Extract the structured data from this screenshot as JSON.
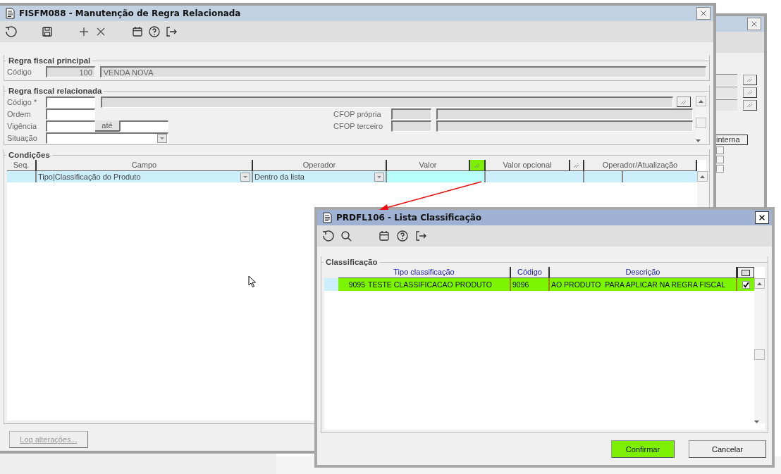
{
  "back_window": {
    "column_header": "interna",
    "checkboxes": [
      {
        "checked": false
      },
      {
        "checked": false
      },
      {
        "checked": false
      }
    ]
  },
  "main_window": {
    "title": "FISFM088 - Manutenção de Regra Relacionada",
    "principal": {
      "legend": "Regra fiscal principal",
      "label": "Código",
      "code": "100",
      "description": "VENDA NOVA"
    },
    "relacionada": {
      "legend": "Regra fiscal relacionada",
      "codigo_label": "Código *",
      "ordem_label": "Ordem",
      "vigencia_label": "Vigência",
      "ate_label": "até",
      "situacao_label": "Situação",
      "cfop_propria_label": "CFOP própria",
      "cfop_terceiro_label": "CFOP terceiro"
    },
    "conditions": {
      "legend": "Condições",
      "columns": [
        {
          "kind": "text",
          "label": "Seq.",
          "highlighted": false
        },
        {
          "kind": "text",
          "label": "Campo",
          "highlighted": false
        },
        {
          "kind": "text",
          "label": "Operador",
          "highlighted": false
        },
        {
          "kind": "text",
          "label": "Valor",
          "highlighted": false
        },
        {
          "kind": "lookup",
          "highlighted": true
        },
        {
          "kind": "text",
          "label": "Valor opcional",
          "highlighted": false
        },
        {
          "kind": "lookup",
          "highlighted": false
        },
        {
          "kind": "text",
          "label": "Operador/Atualização",
          "highlighted": false
        }
      ],
      "rows": [
        {
          "seq": "",
          "campo": "Tipo|Classificação do Produto",
          "operador": "Dentro da lista",
          "selected": true
        }
      ]
    },
    "log_button": {
      "label": "Log alterações...",
      "disabled": true
    }
  },
  "dialog": {
    "title": "PRDFL106 - Lista Classificação",
    "legend": "Classificação",
    "columns": [
      "Tipo classificação",
      "Código",
      "Descrição"
    ],
    "rows": [
      {
        "tipo_code": "9095",
        "tipo": "TESTE CLASSIFICACAO PRODUTO",
        "codigo": "9096",
        "descricao": "AO PRODUTO  PARA APLICAR NA REGRA FISCAL",
        "checked": true,
        "selected": true
      }
    ],
    "buttons": [
      {
        "label": "Confirmar",
        "highlighted": true
      },
      {
        "label": "Cancelar",
        "highlighted": false
      }
    ]
  }
}
